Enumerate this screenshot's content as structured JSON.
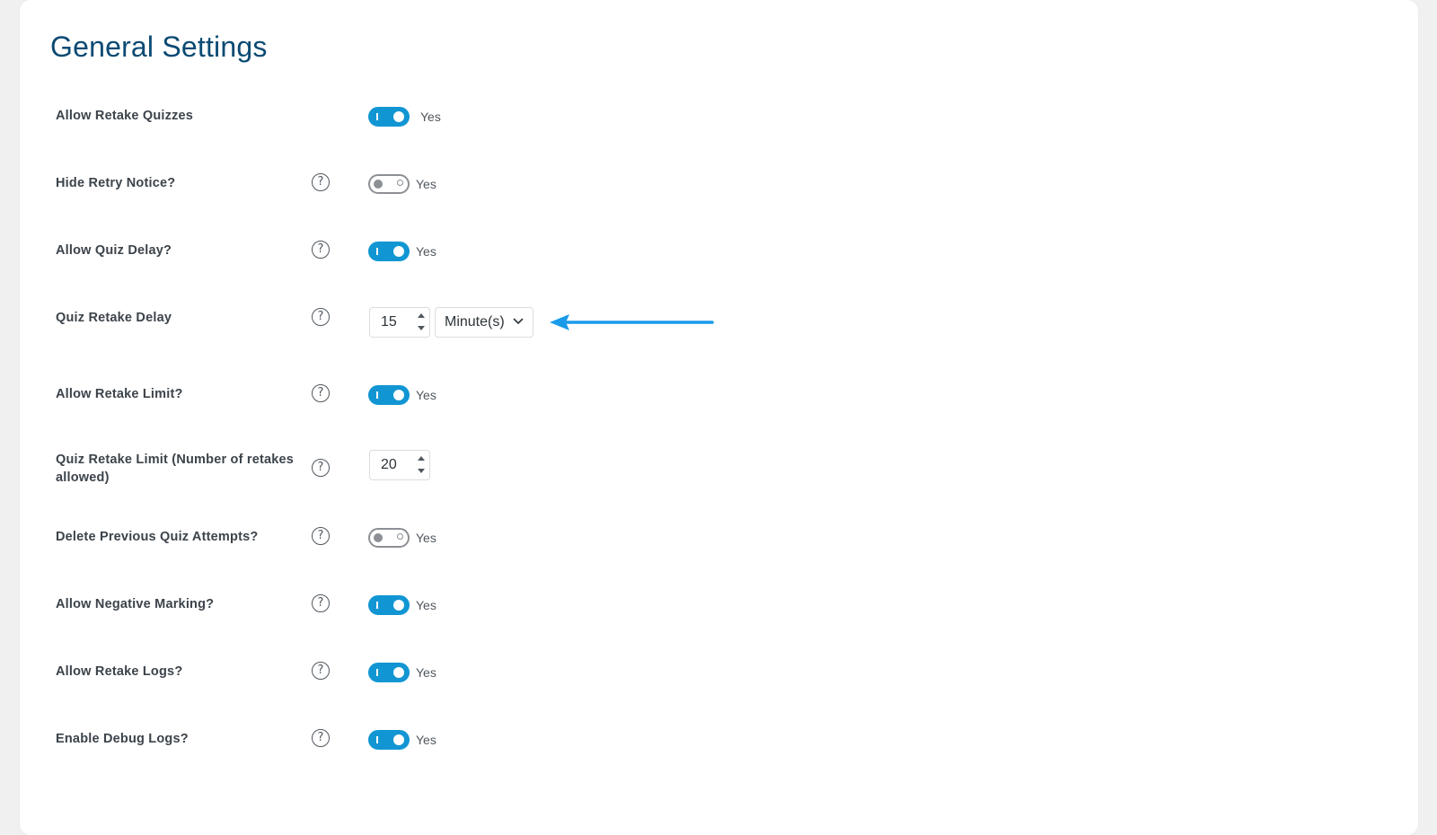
{
  "page": {
    "title": "General Settings"
  },
  "colors": {
    "accent": "#1296d3",
    "title": "#0b4a73",
    "annotation_arrow": "#1a9bea"
  },
  "settings": [
    {
      "label": "Allow Retake Quizzes",
      "type": "toggle",
      "on": true,
      "toggle_text": "Yes",
      "help": false
    },
    {
      "label": "Hide Retry Notice?",
      "type": "toggle",
      "on": false,
      "toggle_text": "Yes",
      "help": true,
      "help_icon": "question-circle-icon"
    },
    {
      "label": "Allow Quiz Delay?",
      "type": "toggle",
      "on": true,
      "toggle_text": "Yes",
      "help": true,
      "help_icon": "question-circle-icon"
    },
    {
      "label": "Quiz Retake Delay",
      "type": "number-select",
      "value": "15",
      "unit": "Minute(s)",
      "help": true,
      "help_icon": "question-circle-icon"
    },
    {
      "label": "Allow Retake Limit?",
      "type": "toggle",
      "on": true,
      "toggle_text": "Yes",
      "help": true,
      "help_icon": "question-circle-icon"
    },
    {
      "label_line1": "Quiz Retake Limit (Number of retakes",
      "label_line2": "allowed)",
      "type": "number",
      "value": "20",
      "help": true,
      "help_icon": "question-circle-icon"
    },
    {
      "label": "Delete Previous Quiz Attempts?",
      "type": "toggle",
      "on": false,
      "toggle_text": "Yes",
      "help": true,
      "help_icon": "question-circle-icon"
    },
    {
      "label": "Allow Negative Marking?",
      "type": "toggle",
      "on": true,
      "toggle_text": "Yes",
      "help": true,
      "help_icon": "question-circle-icon"
    },
    {
      "label": "Allow Retake Logs?",
      "type": "toggle",
      "on": true,
      "toggle_text": "Yes",
      "help": true,
      "help_icon": "question-circle-icon"
    },
    {
      "label": "Enable Debug Logs?",
      "type": "toggle",
      "on": true,
      "toggle_text": "Yes",
      "help": true,
      "help_icon": "question-circle-icon"
    }
  ],
  "help_glyph": "?"
}
